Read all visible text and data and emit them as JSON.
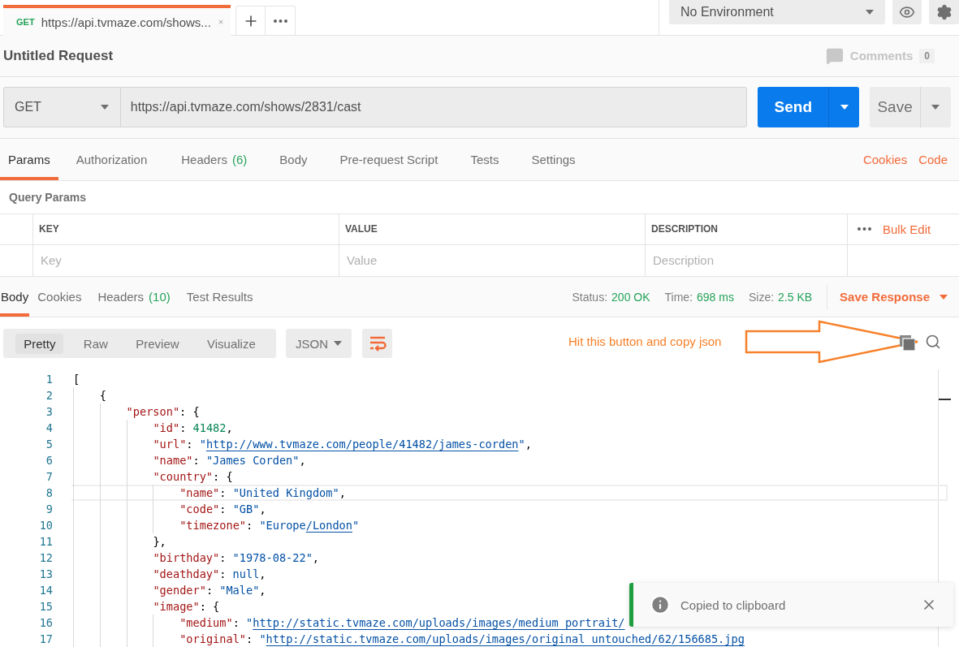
{
  "request_tabs": [
    {
      "method": "GET",
      "title": "https://api.tvmaze.com/shows...",
      "selected": true
    }
  ],
  "environment": {
    "value": "No Environment"
  },
  "request": {
    "title": "Untitled Request",
    "comments_label": "Comments",
    "comments_count": "0",
    "method": "GET",
    "url": "https://api.tvmaze.com/shows/2831/cast",
    "send_label": "Send",
    "save_label": "Save"
  },
  "request_sections": [
    {
      "label": "Params",
      "selected": true
    },
    {
      "label": "Authorization",
      "selected": false
    },
    {
      "label": "Headers",
      "count": "(6)",
      "selected": false
    },
    {
      "label": "Body",
      "selected": false
    },
    {
      "label": "Pre-request Script",
      "selected": false
    },
    {
      "label": "Tests",
      "selected": false
    },
    {
      "label": "Settings",
      "selected": false
    }
  ],
  "request_links": [
    "Cookies",
    "Code"
  ],
  "query_params": {
    "title": "Query Params",
    "columns": [
      "KEY",
      "VALUE",
      "DESCRIPTION"
    ],
    "bulk_edit": "Bulk Edit",
    "placeholders": [
      "Key",
      "Value",
      "Description"
    ]
  },
  "response_sections": [
    {
      "label": "Body",
      "selected": true
    },
    {
      "label": "Cookies",
      "selected": false
    },
    {
      "label": "Headers",
      "count": "(10)",
      "selected": false
    },
    {
      "label": "Test Results",
      "selected": false
    }
  ],
  "response_stats": [
    {
      "label": "Status:",
      "value": "200 OK"
    },
    {
      "label": "Time:",
      "value": "698 ms"
    },
    {
      "label": "Size:",
      "value": "2.5 KB"
    }
  ],
  "save_response": "Save Response",
  "view_modes": [
    {
      "label": "Pretty",
      "selected": true
    },
    {
      "label": "Raw",
      "selected": false
    },
    {
      "label": "Preview",
      "selected": false
    },
    {
      "label": "Visualize",
      "selected": false
    }
  ],
  "format": "JSON",
  "annotation": "Hit this button and copy json",
  "code_lines": [
    {
      "number": "1",
      "selected": false,
      "tokens": [
        {
          "kind": "punct",
          "text": "["
        }
      ],
      "children": [
        {
          "number": "2",
          "selected": false,
          "tokens": [
            {
              "kind": "punct",
              "text": "{"
            }
          ],
          "children": [
            {
              "number": "3",
              "selected": false,
              "tokens": [
                {
                  "kind": "key",
                  "text": "\"person\""
                },
                {
                  "kind": "punct",
                  "text": ": {"
                }
              ],
              "children": [
                {
                  "number": "4",
                  "selected": false,
                  "tokens": [
                    {
                      "kind": "key",
                      "text": "\"id\""
                    },
                    {
                      "kind": "punct",
                      "text": ": "
                    },
                    {
                      "kind": "number",
                      "text": "41482"
                    },
                    {
                      "kind": "punct",
                      "text": ","
                    }
                  ]
                },
                {
                  "number": "5",
                  "selected": false,
                  "tokens": [
                    {
                      "kind": "key",
                      "text": "\"url\""
                    },
                    {
                      "kind": "punct",
                      "text": ": "
                    },
                    {
                      "kind": "string",
                      "text": "\""
                    },
                    {
                      "kind": "link",
                      "text": "http://www.tvmaze.com/people/41482/james-corden"
                    },
                    {
                      "kind": "string",
                      "text": "\""
                    },
                    {
                      "kind": "punct",
                      "text": ","
                    }
                  ]
                },
                {
                  "number": "6",
                  "selected": false,
                  "tokens": [
                    {
                      "kind": "key",
                      "text": "\"name\""
                    },
                    {
                      "kind": "punct",
                      "text": ": "
                    },
                    {
                      "kind": "string",
                      "text": "\"James Corden\""
                    },
                    {
                      "kind": "punct",
                      "text": ","
                    }
                  ]
                },
                {
                  "number": "7",
                  "selected": false,
                  "tokens": [
                    {
                      "kind": "key",
                      "text": "\"country\""
                    },
                    {
                      "kind": "punct",
                      "text": ": {"
                    }
                  ],
                  "children": [
                    {
                      "number": "8",
                      "selected": true,
                      "tokens": [
                        {
                          "kind": "key",
                          "text": "\"name\""
                        },
                        {
                          "kind": "punct",
                          "text": ": "
                        },
                        {
                          "kind": "string",
                          "text": "\"United Kingdom\""
                        },
                        {
                          "kind": "punct",
                          "text": ","
                        }
                      ]
                    },
                    {
                      "number": "9",
                      "selected": false,
                      "tokens": [
                        {
                          "kind": "key",
                          "text": "\"code\""
                        },
                        {
                          "kind": "punct",
                          "text": ": "
                        },
                        {
                          "kind": "string",
                          "text": "\"GB\""
                        },
                        {
                          "kind": "punct",
                          "text": ","
                        }
                      ]
                    },
                    {
                      "number": "10",
                      "selected": false,
                      "tokens": [
                        {
                          "kind": "key",
                          "text": "\"timezone\""
                        },
                        {
                          "kind": "punct",
                          "text": ": "
                        },
                        {
                          "kind": "string",
                          "text": "\"Europe"
                        },
                        {
                          "kind": "link",
                          "text": "/London"
                        },
                        {
                          "kind": "string",
                          "text": "\""
                        }
                      ]
                    }
                  ]
                },
                {
                  "number": "11",
                  "selected": false,
                  "tokens": [
                    {
                      "kind": "punct",
                      "text": "},"
                    }
                  ]
                },
                {
                  "number": "12",
                  "selected": false,
                  "tokens": [
                    {
                      "kind": "key",
                      "text": "\"birthday\""
                    },
                    {
                      "kind": "punct",
                      "text": ": "
                    },
                    {
                      "kind": "string",
                      "text": "\"1978-08-22\""
                    },
                    {
                      "kind": "punct",
                      "text": ","
                    }
                  ]
                },
                {
                  "number": "13",
                  "selected": false,
                  "tokens": [
                    {
                      "kind": "key",
                      "text": "\"deathday\""
                    },
                    {
                      "kind": "punct",
                      "text": ": "
                    },
                    {
                      "kind": "string",
                      "text": "null"
                    },
                    {
                      "kind": "punct",
                      "text": ","
                    }
                  ]
                },
                {
                  "number": "14",
                  "selected": false,
                  "tokens": [
                    {
                      "kind": "key",
                      "text": "\"gender\""
                    },
                    {
                      "kind": "punct",
                      "text": ": "
                    },
                    {
                      "kind": "string",
                      "text": "\"Male\""
                    },
                    {
                      "kind": "punct",
                      "text": ","
                    }
                  ]
                },
                {
                  "number": "15",
                  "selected": false,
                  "tokens": [
                    {
                      "kind": "key",
                      "text": "\"image\""
                    },
                    {
                      "kind": "punct",
                      "text": ": {"
                    }
                  ],
                  "children": [
                    {
                      "number": "16",
                      "selected": false,
                      "tokens": [
                        {
                          "kind": "key",
                          "text": "\"medium\""
                        },
                        {
                          "kind": "punct",
                          "text": ": "
                        },
                        {
                          "kind": "string",
                          "text": "\""
                        },
                        {
                          "kind": "link",
                          "text": "http://static.tvmaze.com/uploads/images/medium_portrait/"
                        }
                      ]
                    },
                    {
                      "number": "17",
                      "selected": false,
                      "tokens": [
                        {
                          "kind": "key",
                          "text": "\"original\""
                        },
                        {
                          "kind": "punct",
                          "text": ": "
                        },
                        {
                          "kind": "string",
                          "text": "\""
                        },
                        {
                          "kind": "link",
                          "text": "http://static.tvmaze.com/uploads/images/original_untouched/62/156685.jpg"
                        }
                      ]
                    }
                  ]
                }
              ]
            }
          ]
        }
      ]
    }
  ],
  "toast": {
    "message": "Copied to clipboard"
  }
}
